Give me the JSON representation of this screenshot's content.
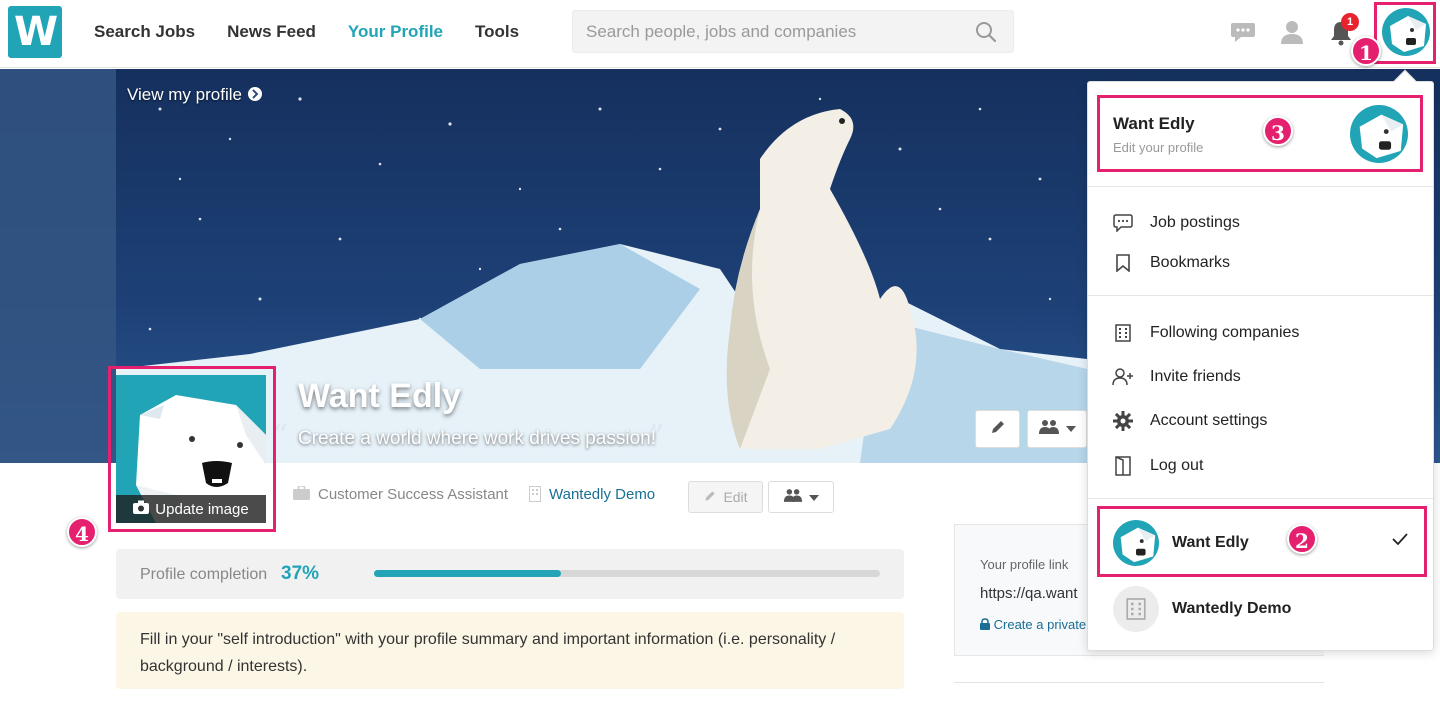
{
  "nav": {
    "logo": "W",
    "items": [
      {
        "label": "Search Jobs",
        "active": false
      },
      {
        "label": "News Feed",
        "active": false
      },
      {
        "label": "Your Profile",
        "active": true
      },
      {
        "label": "Tools",
        "active": false
      }
    ],
    "search_placeholder": "Search people, jobs and companies",
    "notification_count": "1"
  },
  "cover": {
    "view_profile": "View my profile",
    "name": "Want Edly",
    "tagline": "Create a world where work drives passion!"
  },
  "profile": {
    "update_image": "Update image",
    "job_title": "Customer Success Assistant",
    "company": "Wantedly Demo",
    "edit_label": "Edit",
    "completion_label": "Profile completion",
    "completion_pct": "37%",
    "completion_value": 0.37,
    "hint": "Fill in your \"self introduction\" with your profile summary and important information (i.e. personality / background / interests)."
  },
  "side_panel": {
    "link_label": "Your profile link",
    "url": "https://qa.want",
    "private_link": "Create a private"
  },
  "dropdown": {
    "user_name": "Want Edly",
    "user_sub": "Edit your profile",
    "group1": [
      {
        "label": "Job postings",
        "icon": "chat-bubble-icon"
      },
      {
        "label": "Bookmarks",
        "icon": "bookmark-icon"
      }
    ],
    "group2": [
      {
        "label": "Following companies",
        "icon": "building-icon"
      },
      {
        "label": "Invite friends",
        "icon": "add-user-icon"
      },
      {
        "label": "Account settings",
        "icon": "gear-icon"
      },
      {
        "label": "Log out",
        "icon": "logout-icon"
      }
    ],
    "accounts": [
      {
        "name": "Want Edly",
        "selected": true
      },
      {
        "name": "Wantedly Demo",
        "selected": false
      }
    ]
  },
  "annotations": [
    "1",
    "2",
    "3",
    "4"
  ],
  "colors": {
    "brand": "#21a4b6",
    "annotation": "#e5206f",
    "badge": "#e8232f"
  }
}
